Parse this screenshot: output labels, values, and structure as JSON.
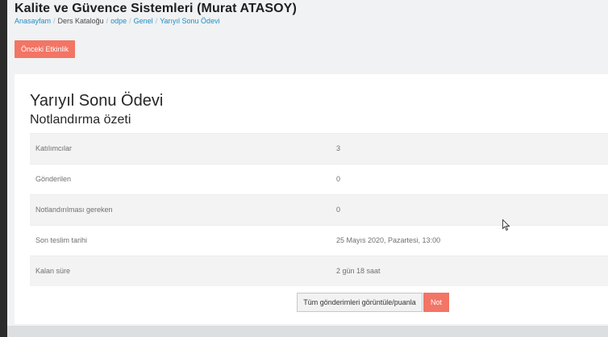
{
  "header": {
    "course_title": "Kalite ve Güvence Sistemleri (Murat ATASOY)",
    "breadcrumb": [
      "Anasayfam",
      "Ders Kataloğu",
      "odpe",
      "Genel",
      "Yarıyıl Sonu Ödevi"
    ]
  },
  "navigation": {
    "previous_activity_label": "Önceki Etkinlik"
  },
  "assignment": {
    "title": "Yarıyıl Sonu Ödevi",
    "grading_summary_heading": "Notlandırma özeti",
    "summary_rows": [
      {
        "label": "Katılımcılar",
        "value": "3"
      },
      {
        "label": "Gönderilen",
        "value": "0"
      },
      {
        "label": "Notlandırılması gereken",
        "value": "0"
      },
      {
        "label": "Son teslim tarihi",
        "value": "25 Mayıs 2020, Pazartesi, 13:00"
      },
      {
        "label": "Kalan süre",
        "value": "2 gün 18 saat"
      }
    ],
    "view_all_submissions_label": "Tüm gönderimleri görüntüle/puanla",
    "grade_label": "Not"
  },
  "colors": {
    "accent": "#f27565",
    "link": "#1e8ec6"
  }
}
